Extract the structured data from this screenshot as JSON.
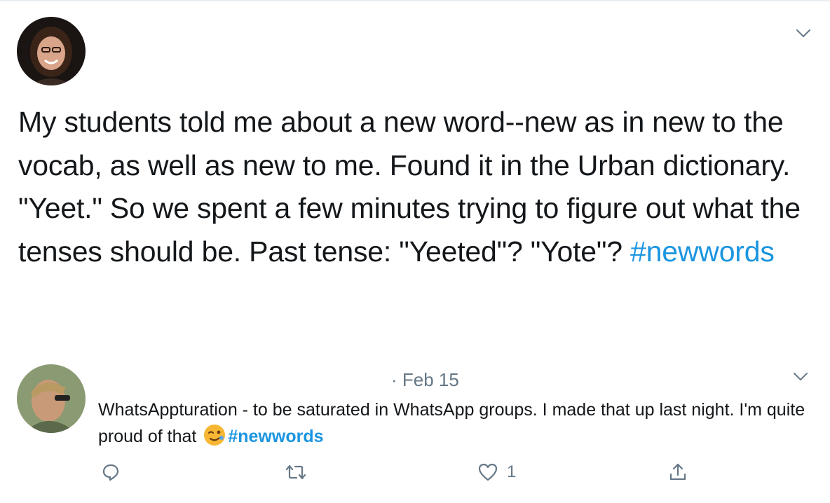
{
  "tweet": {
    "text_plain": "My students told me about a new word--new as in new to the vocab, as well as new to me. Found it in the Urban dictionary. \"Yeet.\" So we spent a few minutes trying to figure out what the tenses should be. Past tense: \"Yeeted\"? \"Yote\"?",
    "hashtag": "#newwords"
  },
  "reply": {
    "meta": "· Feb 15",
    "text_plain": "WhatsAppturation - to be saturated in WhatsApp groups. I made that up last night. I'm quite proud of that",
    "hashtag": "#newwords",
    "actions": {
      "like_count": "1"
    }
  },
  "icons": {
    "main_chevron": "chevron-down-icon",
    "reply_chevron": "chevron-down-icon",
    "reply": "reply-bubble-icon",
    "retweet": "retweet-icon",
    "like": "heart-icon",
    "share": "share-icon",
    "emoji": "winking-face-emoji"
  },
  "colors": {
    "hashtag": "#1b95e0",
    "muted": "#657786",
    "text": "#14171a",
    "border": "#e6ecf0"
  }
}
